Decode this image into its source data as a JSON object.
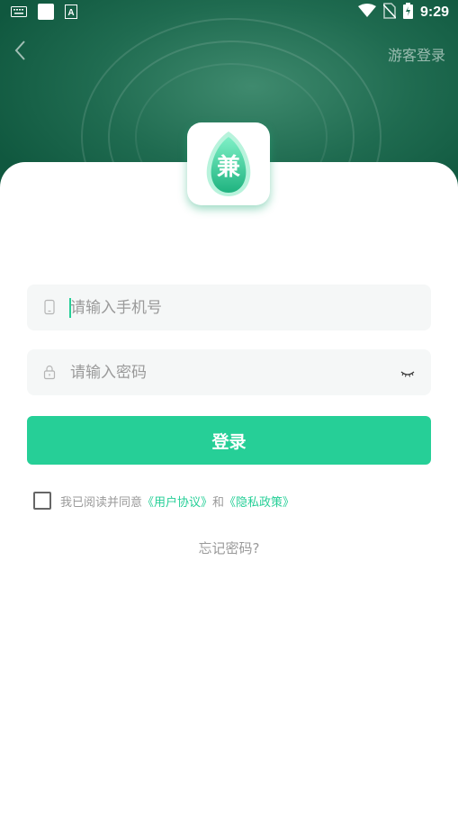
{
  "status_bar": {
    "time": "9:29",
    "icons": [
      "keyboard-icon",
      "notification-square-icon",
      "text-icon",
      "wifi-icon",
      "no-sim-icon",
      "battery-charging-icon"
    ]
  },
  "header": {
    "back_icon": "chevron-left-icon",
    "guest_login": "游客登录"
  },
  "logo": {
    "char": "兼",
    "accent": "#26cf97"
  },
  "form": {
    "phone_placeholder": "请输入手机号",
    "password_placeholder": "请输入密码",
    "login_label": "登录"
  },
  "agreement": {
    "prefix": "我已阅读并同意",
    "user_agreement": "《用户协议》",
    "and": "和",
    "privacy_policy": "《隐私政策》"
  },
  "forgot_password": "忘记密码?",
  "colors": {
    "accent": "#26cf97",
    "header": "#1f6b50"
  }
}
